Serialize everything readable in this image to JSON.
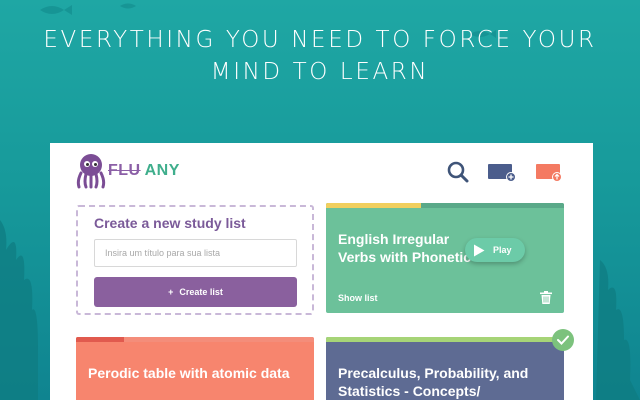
{
  "headline": {
    "line1": "EVERYTHING YOU NEED TO FORCE YOUR",
    "line2": "MIND TO LEARN"
  },
  "logo": {
    "part1": "FLU",
    "part2": "ANY",
    "mascot": "octopus-icon"
  },
  "toolbar": {
    "icons": [
      "search-icon",
      "add-screen-icon",
      "upload-icon"
    ]
  },
  "new_list": {
    "title": "Create a new study list",
    "input_placeholder": "Insira um título para sua lista",
    "input_value": "",
    "button_label": "Create list",
    "button_icon": "plus-icon"
  },
  "cards": [
    {
      "title": "English Irregular Verbs with Phonetic",
      "progress": 0.4,
      "show_list_label": "Show list",
      "play_label": "Play",
      "colors": {
        "body": "#6cc19a",
        "bar": "#f1cf5e"
      }
    },
    {
      "title": "Perodic table with atomic data",
      "progress": 0.2,
      "colors": {
        "body": "#f7856e",
        "bar": "#e15a4e"
      }
    },
    {
      "title": "Precalculus, Probability, and Statistics - Concepts/",
      "progress": 1.0,
      "completed": true,
      "colors": {
        "body": "#5e6b93",
        "bar": "#a6d477"
      }
    }
  ],
  "colors": {
    "accent_purple": "#8a609e",
    "brand_green": "#3fae8c",
    "background_sea": "#1fa7a4"
  }
}
